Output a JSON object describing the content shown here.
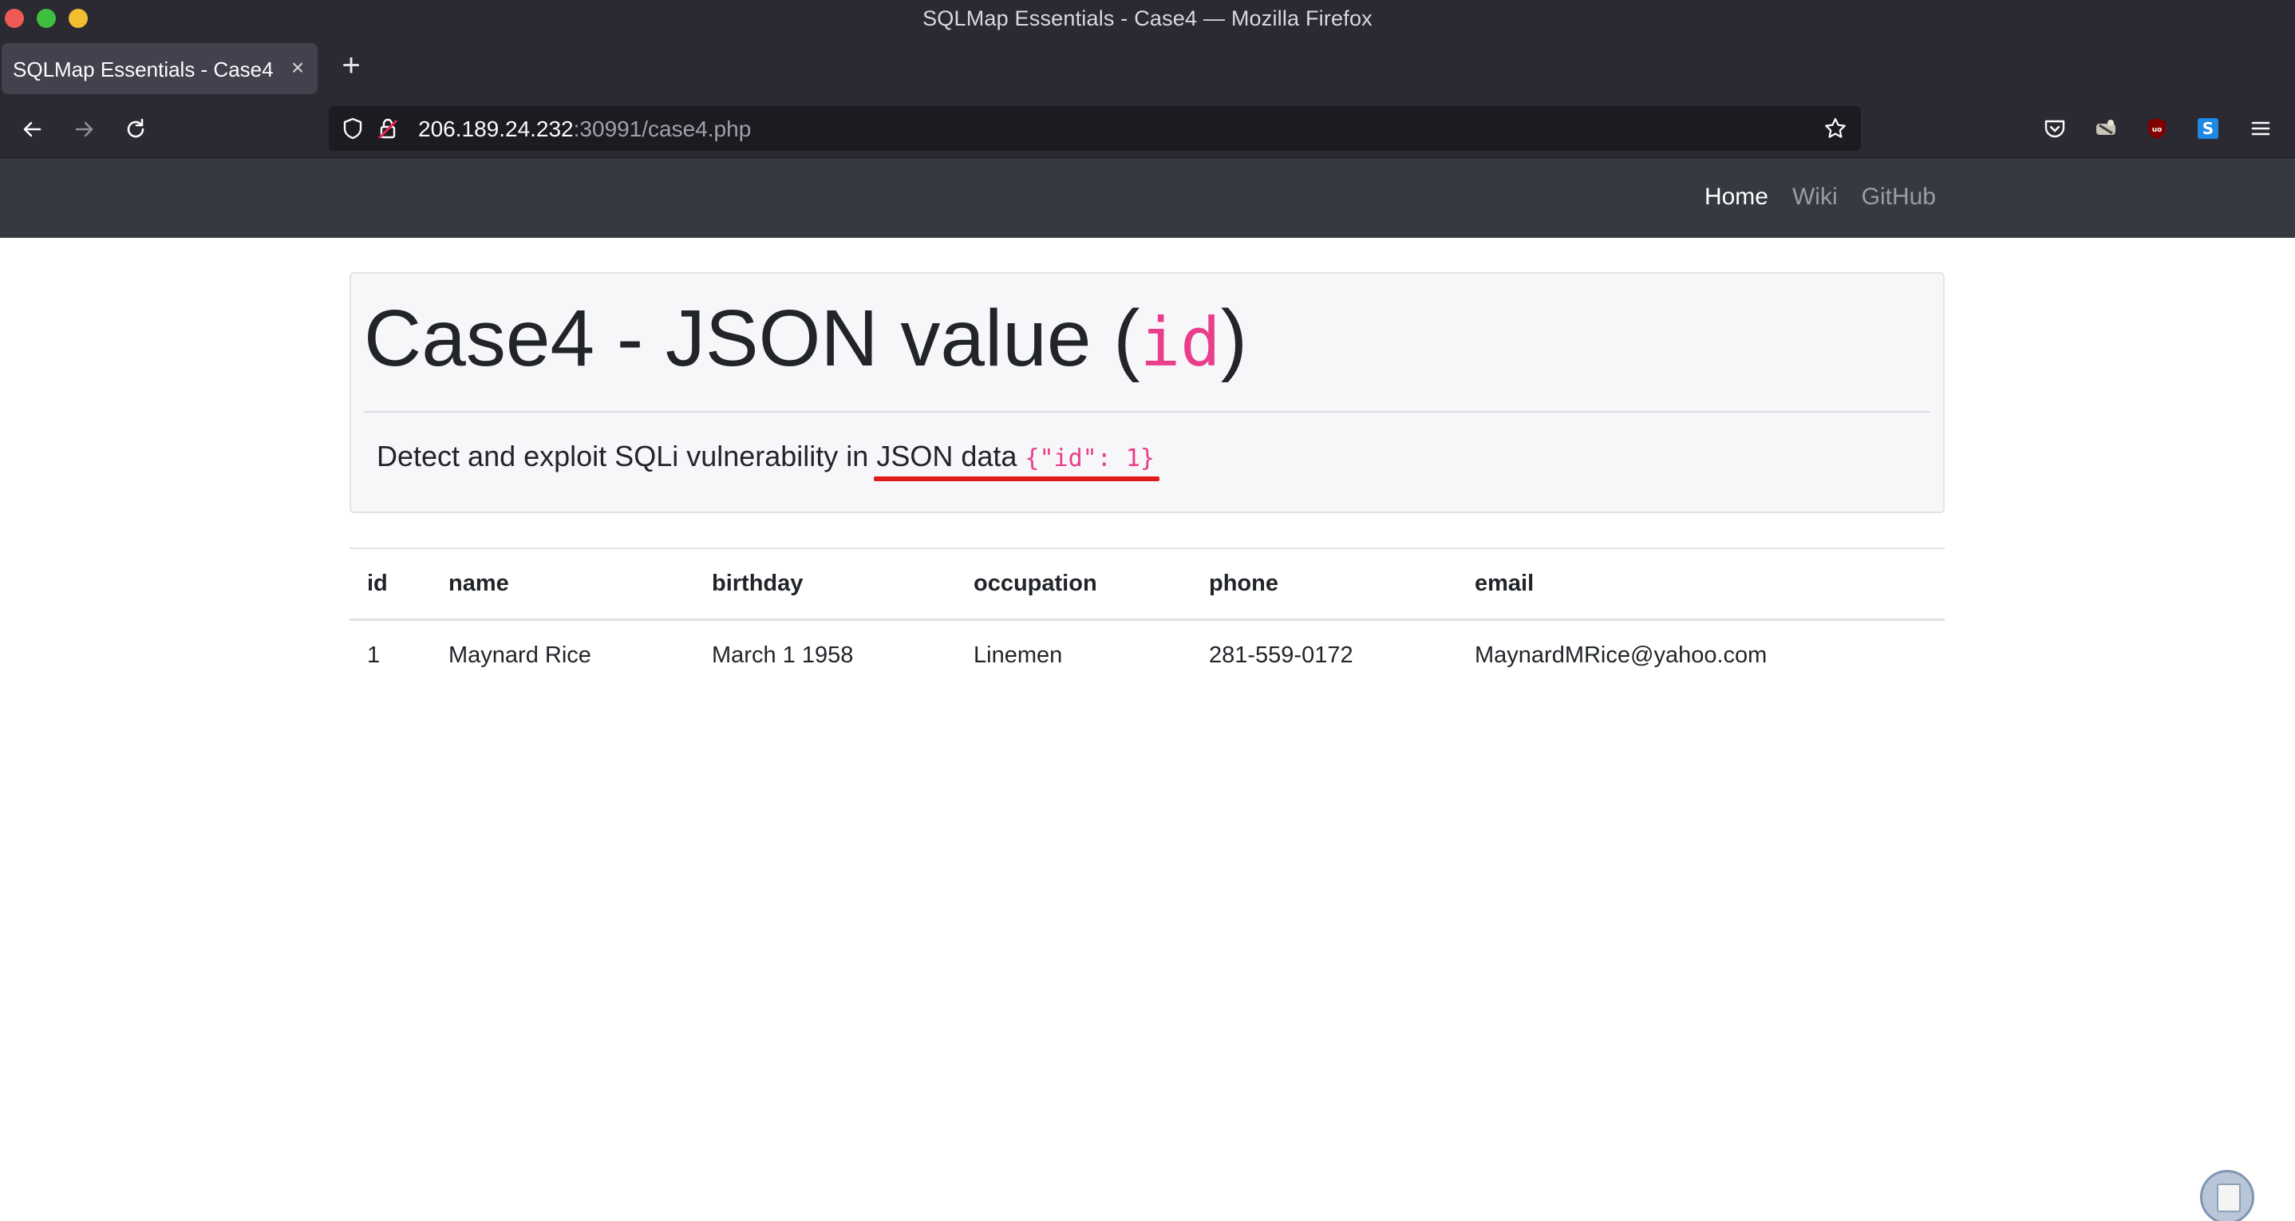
{
  "window": {
    "title": "SQLMap Essentials - Case4 — Mozilla Firefox"
  },
  "tab": {
    "label": "SQLMap Essentials - Case4",
    "close": "×"
  },
  "new_tab": "+",
  "url": {
    "host": "206.189.24.232",
    "rest": ":30991/case4.php"
  },
  "toolbar_icons": [
    "back-icon",
    "forward-icon",
    "reload-icon",
    "shield-icon",
    "insecure-lock-icon",
    "star-icon",
    "pocket-icon",
    "extension-icon",
    "ublock-icon",
    "s-extension-icon",
    "menu-icon"
  ],
  "site_nav": {
    "home": "Home",
    "wiki": "Wiki",
    "github": "GitHub"
  },
  "jumbotron": {
    "title_prefix": "Case4 - JSON value (",
    "title_code": "id",
    "title_suffix": ")",
    "lead_text": "Detect and exploit SQLi vulnerability in JSON data ",
    "lead_code": "{\"id\": 1}"
  },
  "table": {
    "headers": [
      "id",
      "name",
      "birthday",
      "occupation",
      "phone",
      "email"
    ],
    "rows": [
      [
        "1",
        "Maynard Rice",
        "March 1 1958",
        "Linemen",
        "281-559-0172",
        "MaynardMRice@yahoo.com"
      ]
    ]
  },
  "colors": {
    "browser_bg": "#2b2a33",
    "site_nav_bg": "#343a40",
    "code_pink": "#e83e8c",
    "annotation_red": "#e01b1b"
  }
}
